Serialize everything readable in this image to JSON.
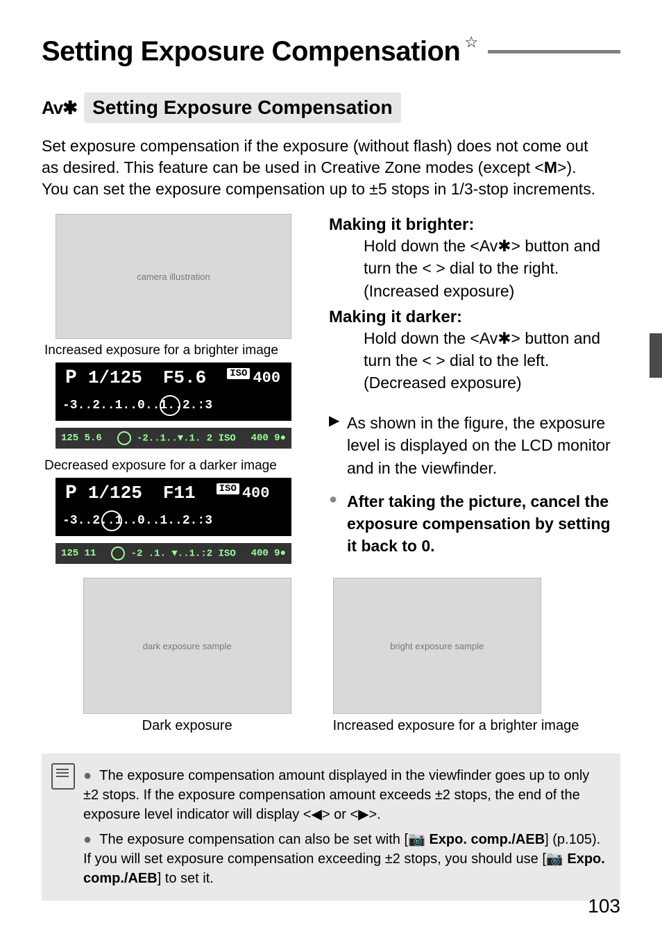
{
  "title": "Setting Exposure Compensation",
  "star": "☆",
  "subhead_icon": "Av✱",
  "subhead": "Setting Exposure Compensation",
  "intro_line1": "Set exposure compensation if the exposure (without flash) does not come out",
  "intro_line2": "as desired. This feature can be used in Creative Zone modes (except <",
  "intro_mode": "M",
  "intro_line2b": ">).",
  "intro_line3": "You can set the exposure compensation up to ±5 stops in 1/3-stop increments.",
  "camera_ph": "camera illustration",
  "cap_brighter": "Increased exposure for a brighter image",
  "cap_darker": "Decreased exposure for a darker image",
  "lcd1": {
    "p": "P",
    "shutter": "1/125",
    "ap": "F5.6",
    "iso_tag": "ISO",
    "iso": "400",
    "scale": "-3..2..1..0..1..2.:3"
  },
  "vf1": {
    "left": "125  5.6",
    "mid": "-2..1..▼.1.  2 ISO",
    "right": "400   9●"
  },
  "lcd2": {
    "p": "P",
    "shutter": "1/125",
    "ap": "F11",
    "iso_tag": "ISO",
    "iso": "400",
    "scale": "-3..2..1..0..1..2.:3"
  },
  "vf2": {
    "left": "125  11",
    "mid": "-2 .1. ▼..1.:2 ISO",
    "right": "400   9●"
  },
  "right": {
    "h_brighter": "Making it brighter:",
    "brighter_l1": "Hold down the <Av✱> button and",
    "brighter_l2": "turn the <      > dial to the right.",
    "brighter_l3": "(Increased exposure)",
    "h_darker": "Making it darker:",
    "darker_l1": "Hold down the <Av✱> button and",
    "darker_l2": "turn the <      > dial to the left.",
    "darker_l3": "(Decreased exposure)",
    "tri": "▶",
    "tri_txt": "As shown in the figure, the exposure level is displayed on the LCD monitor and in the viewfinder.",
    "circ": "●",
    "circ_txt": "After taking the picture, cancel the exposure compensation by setting it back to 0."
  },
  "photos": {
    "dark_ph": "dark exposure sample",
    "dark_cap": "Dark exposure",
    "bright_ph": "bright exposure sample",
    "bright_cap": "Increased exposure for a brighter image"
  },
  "note": {
    "b": "●",
    "n1": "The exposure compensation amount displayed in the viewfinder goes up to only ±2 stops. If the exposure compensation amount exceeds ±2 stops, the end of the exposure level indicator will display <◀> or <▶>.",
    "n2a": "The exposure compensation can also be set with [",
    "n2b": "📷 Expo. comp./AEB",
    "n2c": "] (p.105). If you will set exposure compensation exceeding ±2 stops, you should use [",
    "n2d": "📷 Expo. comp./AEB",
    "n2e": "] to set it."
  },
  "page_number": "103"
}
